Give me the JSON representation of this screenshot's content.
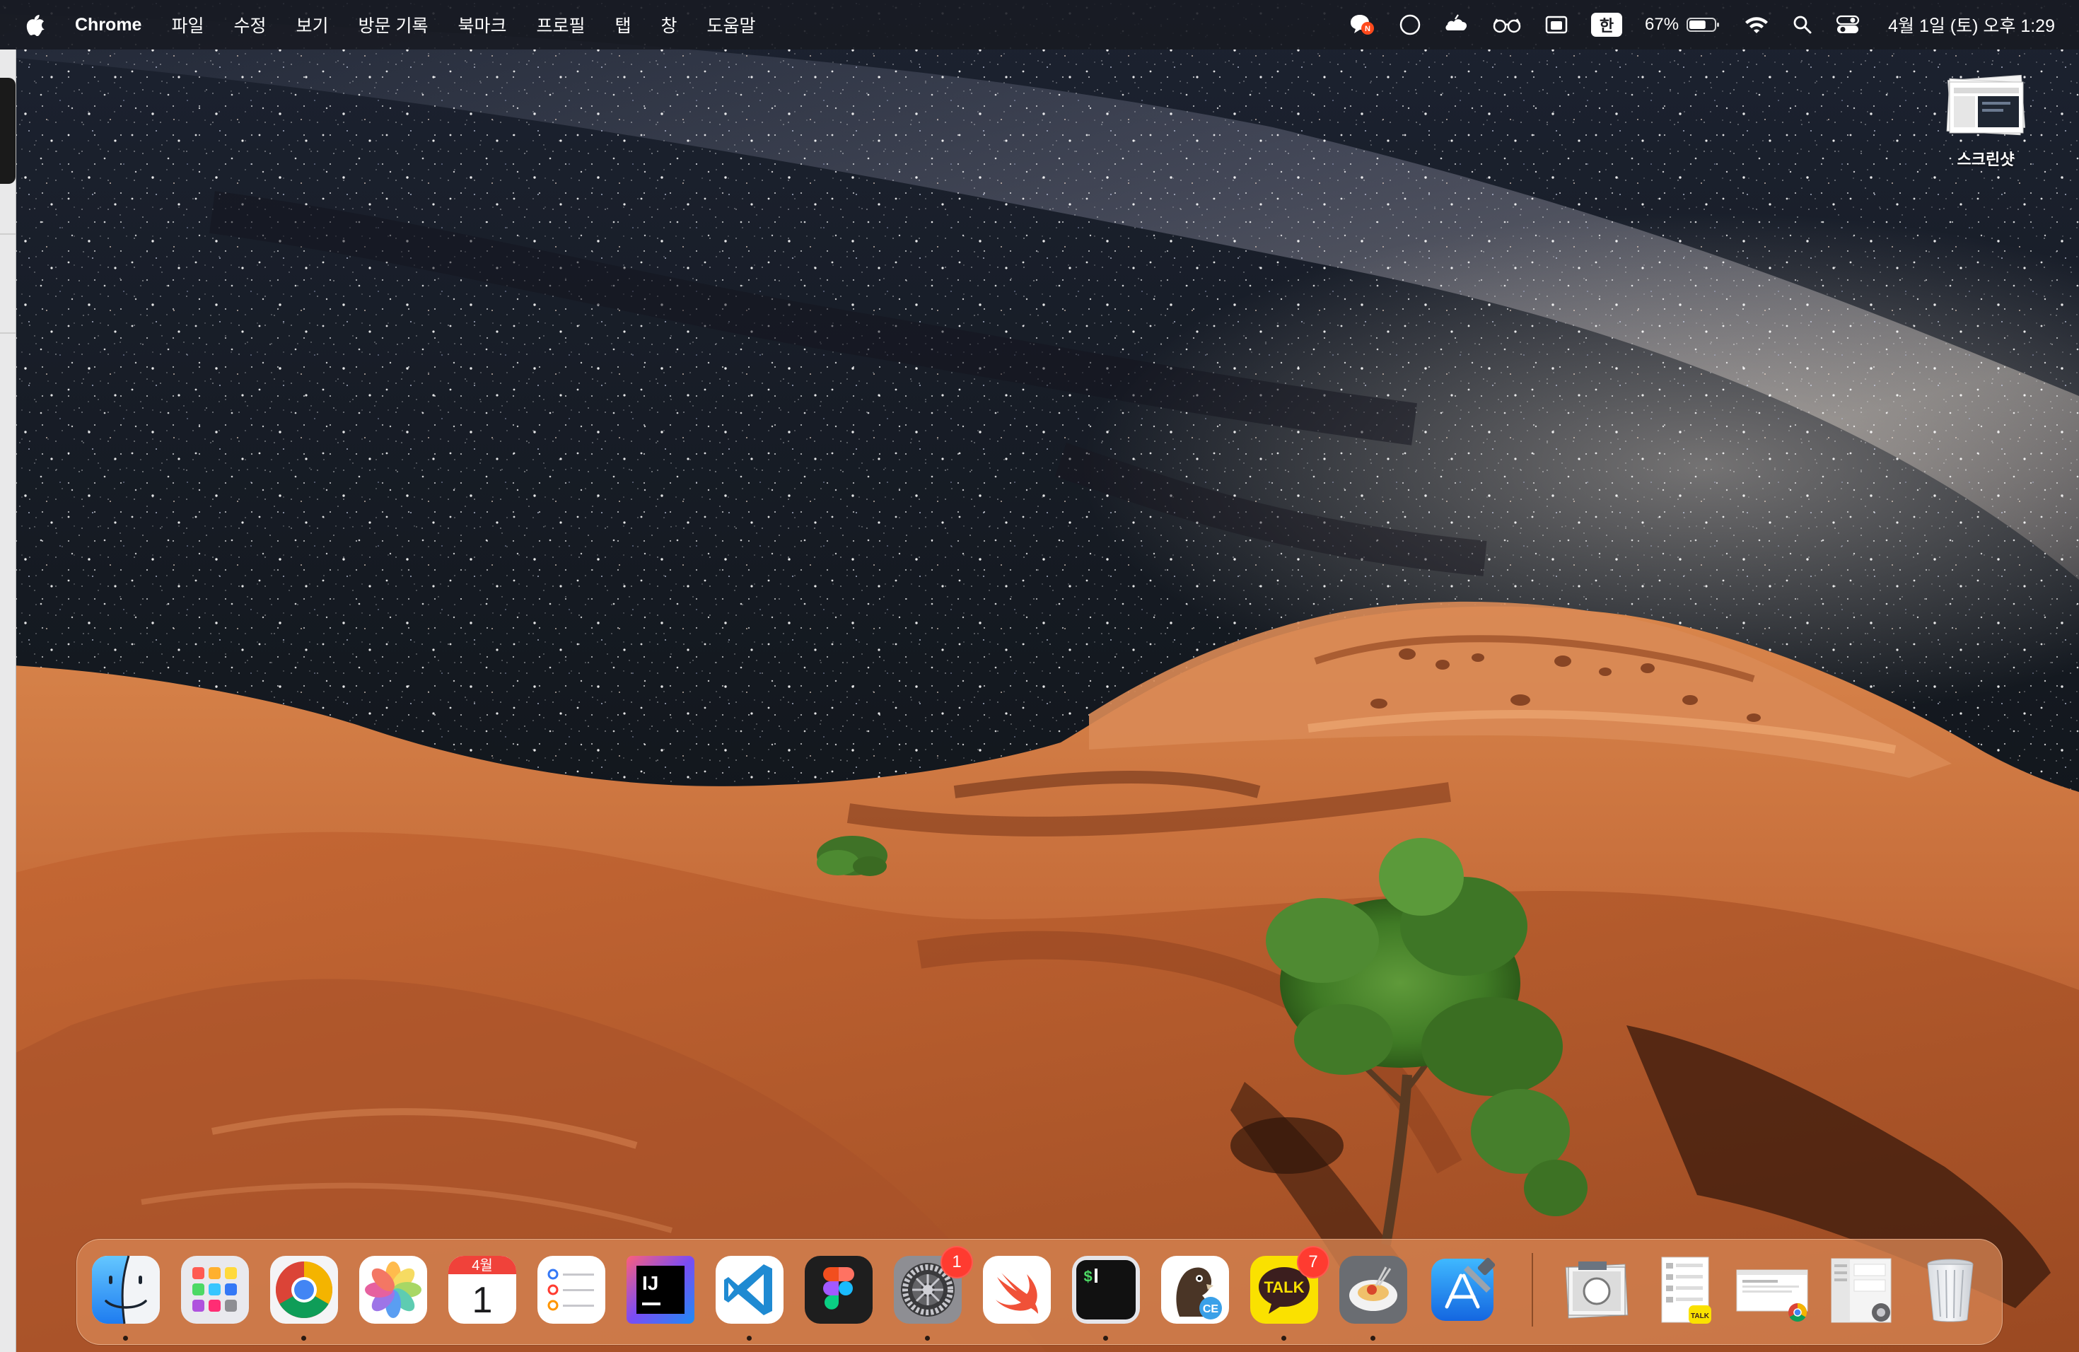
{
  "menubar": {
    "app_name": "Chrome",
    "menus": [
      "파일",
      "수정",
      "보기",
      "방문 기록",
      "북마크",
      "프로필",
      "탭",
      "창",
      "도움말"
    ],
    "input_source": "한",
    "battery_percent": "67%",
    "clock": "4월 1일 (토) 오후 1:29",
    "status_icons": [
      "notification-h-icon",
      "circle-icon",
      "cloud-app-icon",
      "glasses-icon",
      "window-switch-icon",
      "input-source-icon",
      "battery-icon",
      "wifi-icon",
      "spotlight-icon",
      "control-center-icon"
    ]
  },
  "desktop": {
    "icons": [
      {
        "label": "스크린샷"
      }
    ]
  },
  "dock": {
    "apps": [
      {
        "name": "Finder",
        "icon": "finder-icon",
        "running": true
      },
      {
        "name": "Launchpad",
        "icon": "launchpad-icon",
        "running": false
      },
      {
        "name": "Google Chrome",
        "icon": "chrome-icon",
        "running": true
      },
      {
        "name": "Photos",
        "icon": "photos-icon",
        "running": false
      },
      {
        "name": "Calendar",
        "icon": "calendar-icon",
        "running": false,
        "month": "4월",
        "day": "1"
      },
      {
        "name": "Reminders",
        "icon": "reminders-icon",
        "running": false
      },
      {
        "name": "IntelliJ IDEA",
        "icon": "intellij-icon",
        "running": false,
        "text": "IJ"
      },
      {
        "name": "Visual Studio Code",
        "icon": "vscode-icon",
        "running": true
      },
      {
        "name": "Figma",
        "icon": "figma-icon",
        "running": false
      },
      {
        "name": "System Settings",
        "icon": "settings-icon",
        "running": true,
        "badge": "1"
      },
      {
        "name": "Swift Playgrounds",
        "icon": "swift-icon",
        "running": false
      },
      {
        "name": "Terminal",
        "icon": "terminal-icon",
        "running": true,
        "text": "$"
      },
      {
        "name": "DBeaver CE",
        "icon": "dbeaver-icon",
        "running": false,
        "text": "CE"
      },
      {
        "name": "KakaoTalk",
        "icon": "kakaotalk-icon",
        "running": true,
        "badge": "7",
        "text": "TALK"
      },
      {
        "name": "Pasta",
        "icon": "pasta-icon",
        "running": true
      },
      {
        "name": "Xcode",
        "icon": "xcode-icon",
        "running": false
      }
    ],
    "recent": [
      {
        "name": "Screenshot stack",
        "icon": "screenshot-stack-icon"
      },
      {
        "name": "KakaoTalk window",
        "icon": "kakaotalk-window-icon",
        "text": "TALK"
      },
      {
        "name": "Chrome window",
        "icon": "chrome-window-icon"
      },
      {
        "name": "Settings window",
        "icon": "settings-window-icon"
      },
      {
        "name": "Trash",
        "icon": "trash-icon"
      }
    ]
  },
  "colors": {
    "menubar_bg": "#181a22",
    "dock_bg": "#d68452",
    "badge_red": "#ff3b30",
    "sky_dark": "#0f1318",
    "rock_orange": "#c96e3b"
  }
}
